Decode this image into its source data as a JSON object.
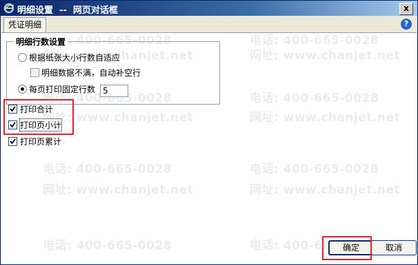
{
  "window": {
    "title": "明细设置  --  网页对话框",
    "close_label": "x"
  },
  "tabs": [
    {
      "label": "凭证明细"
    }
  ],
  "help": {
    "label": "?"
  },
  "detail_rows": {
    "group_title": "明细行数设置",
    "option_auto": "根据纸张大小行数自适应",
    "option_fill": "明细数据不满，自动补空行",
    "option_fixed": "每页打印固定行数",
    "fixed_rows_value": "5",
    "selected": "option_fixed"
  },
  "print_options": {
    "total": {
      "label": "打印合计",
      "checked": true
    },
    "page_subtotal": {
      "label": "打印页小计",
      "checked": true
    },
    "page_cumulative": {
      "label": "打印页累计",
      "checked": true
    }
  },
  "buttons": {
    "ok": "确定",
    "cancel": "取消"
  },
  "watermark": {
    "phone": "电话: 400-665-0028",
    "site": "网址: www.chanjet.net"
  },
  "colors": {
    "highlight": "#e0202a",
    "title_bar": "#0a246a"
  }
}
